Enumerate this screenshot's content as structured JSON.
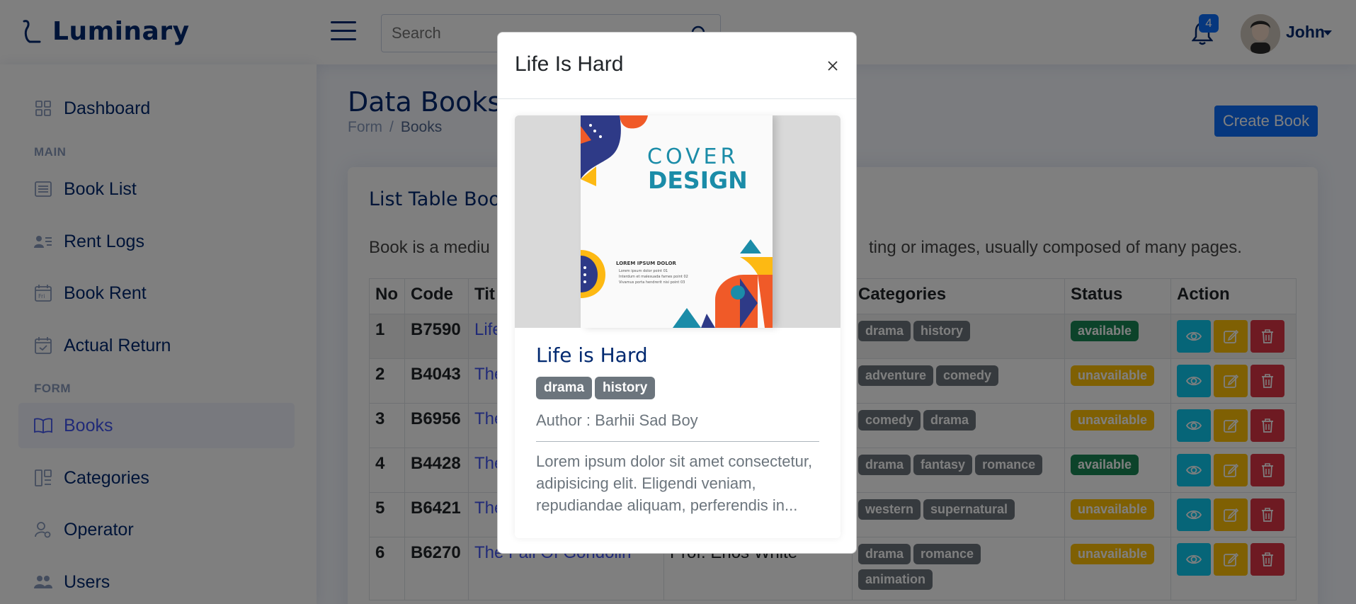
{
  "app": {
    "name": "Luminary"
  },
  "header": {
    "search_placeholder": "Search",
    "notification_count": "4",
    "user_name": "John"
  },
  "sidebar": {
    "dashboard": "Dashboard",
    "heading_main": "MAIN",
    "book_list": "Book List",
    "rent_logs": "Rent Logs",
    "book_rent": "Book Rent",
    "actual_return": "Actual Return",
    "heading_form": "FORM",
    "books": "Books",
    "categories": "Categories",
    "operator": "Operator",
    "users": "Users"
  },
  "page": {
    "title": "Data Books",
    "breadcrumb": [
      "Form",
      "/",
      "Books"
    ],
    "create_button": "Create Book"
  },
  "card": {
    "title": "List Table Boo",
    "description": "Book is a mediu",
    "description_tail": "ting or images, usually composed of many pages."
  },
  "table": {
    "headers": [
      "No",
      "Code",
      "Tit",
      "",
      "Categories",
      "Status",
      "Action"
    ],
    "rows": [
      {
        "no": "1",
        "code": "B7590",
        "title": "Life",
        "author": "",
        "categories": [
          "drama",
          "history"
        ],
        "status": "available"
      },
      {
        "no": "2",
        "code": "B4043",
        "title": "The",
        "author": "",
        "categories": [
          "adventure",
          "comedy"
        ],
        "status": "unavailable"
      },
      {
        "no": "3",
        "code": "B6956",
        "title": "The",
        "author": "",
        "categories": [
          "comedy",
          "drama"
        ],
        "status": "unavailable"
      },
      {
        "no": "4",
        "code": "B4428",
        "title": "The",
        "author": "",
        "categories": [
          "drama",
          "fantasy",
          "romance"
        ],
        "status": "available"
      },
      {
        "no": "5",
        "code": "B6421",
        "title": "The",
        "author": "",
        "categories": [
          "western",
          "supernatural"
        ],
        "status": "unavailable"
      },
      {
        "no": "6",
        "code": "B6270",
        "title": "The Fall Of Gondolin",
        "author": "Prof. Enos White",
        "categories": [
          "drama",
          "romance",
          "animation"
        ],
        "status": "unavailable"
      }
    ]
  },
  "modal": {
    "title": "Life Is Hard",
    "cover": {
      "line1": "COVER",
      "line2": "DESIGN",
      "subheading": "LOREM IPSUM DOLOR",
      "bullets": [
        "Lorem ipsum dolor point 01",
        "Interdum et malesuada fames point 02",
        "Vivamus porta hendrerit nisi point 03"
      ]
    },
    "book_title": "Life is Hard",
    "tags": [
      "drama",
      "history"
    ],
    "author": "Author : Barhii Sad Boy",
    "description": "Lorem ipsum dolor sit amet consectetur, adipisicing elit. Eligendi veniam, repudiandae aliquam, perferendis in..."
  },
  "colors": {
    "primary": "#0d6efd",
    "brand_navy": "#012970",
    "link": "#4154f1",
    "success": "#198754",
    "warning": "#ffc107",
    "info": "#0dcaf0",
    "danger": "#dc3545",
    "tag_gray": "#6c757d"
  }
}
